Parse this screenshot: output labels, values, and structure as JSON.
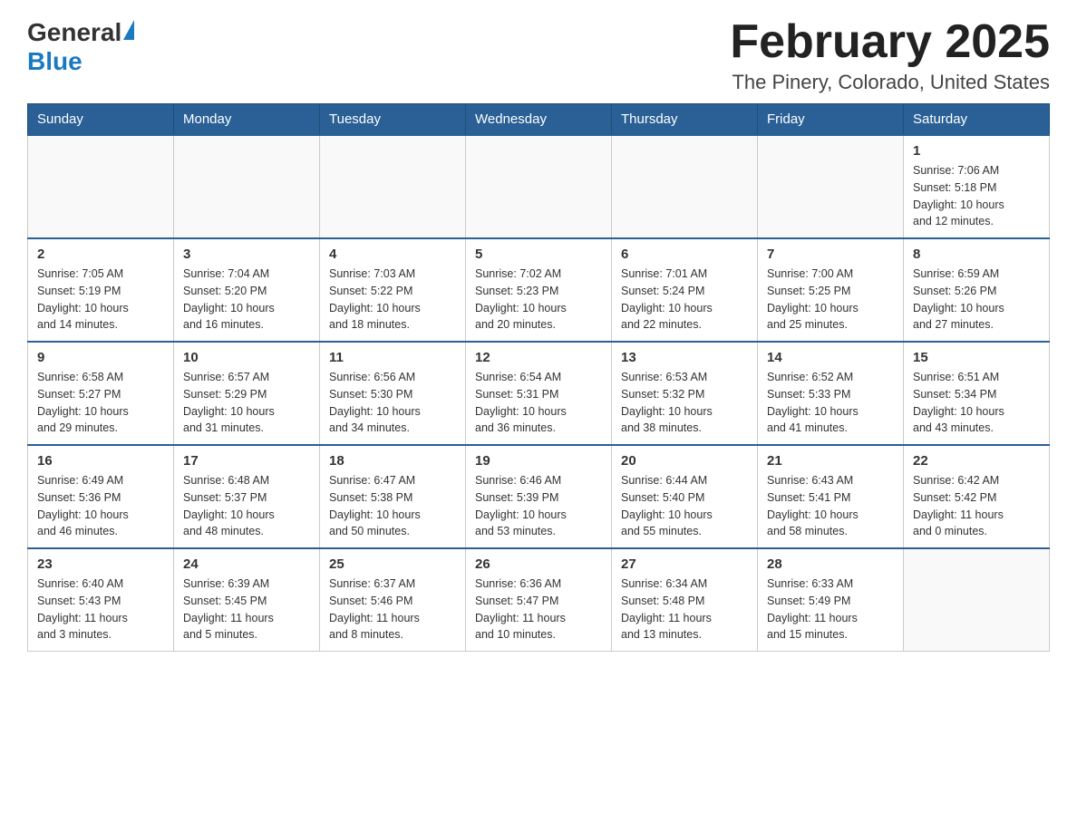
{
  "header": {
    "logo_general": "General",
    "logo_blue": "Blue",
    "month_year": "February 2025",
    "location": "The Pinery, Colorado, United States"
  },
  "weekdays": [
    "Sunday",
    "Monday",
    "Tuesday",
    "Wednesday",
    "Thursday",
    "Friday",
    "Saturday"
  ],
  "weeks": [
    [
      {
        "day": "",
        "info": ""
      },
      {
        "day": "",
        "info": ""
      },
      {
        "day": "",
        "info": ""
      },
      {
        "day": "",
        "info": ""
      },
      {
        "day": "",
        "info": ""
      },
      {
        "day": "",
        "info": ""
      },
      {
        "day": "1",
        "info": "Sunrise: 7:06 AM\nSunset: 5:18 PM\nDaylight: 10 hours\nand 12 minutes."
      }
    ],
    [
      {
        "day": "2",
        "info": "Sunrise: 7:05 AM\nSunset: 5:19 PM\nDaylight: 10 hours\nand 14 minutes."
      },
      {
        "day": "3",
        "info": "Sunrise: 7:04 AM\nSunset: 5:20 PM\nDaylight: 10 hours\nand 16 minutes."
      },
      {
        "day": "4",
        "info": "Sunrise: 7:03 AM\nSunset: 5:22 PM\nDaylight: 10 hours\nand 18 minutes."
      },
      {
        "day": "5",
        "info": "Sunrise: 7:02 AM\nSunset: 5:23 PM\nDaylight: 10 hours\nand 20 minutes."
      },
      {
        "day": "6",
        "info": "Sunrise: 7:01 AM\nSunset: 5:24 PM\nDaylight: 10 hours\nand 22 minutes."
      },
      {
        "day": "7",
        "info": "Sunrise: 7:00 AM\nSunset: 5:25 PM\nDaylight: 10 hours\nand 25 minutes."
      },
      {
        "day": "8",
        "info": "Sunrise: 6:59 AM\nSunset: 5:26 PM\nDaylight: 10 hours\nand 27 minutes."
      }
    ],
    [
      {
        "day": "9",
        "info": "Sunrise: 6:58 AM\nSunset: 5:27 PM\nDaylight: 10 hours\nand 29 minutes."
      },
      {
        "day": "10",
        "info": "Sunrise: 6:57 AM\nSunset: 5:29 PM\nDaylight: 10 hours\nand 31 minutes."
      },
      {
        "day": "11",
        "info": "Sunrise: 6:56 AM\nSunset: 5:30 PM\nDaylight: 10 hours\nand 34 minutes."
      },
      {
        "day": "12",
        "info": "Sunrise: 6:54 AM\nSunset: 5:31 PM\nDaylight: 10 hours\nand 36 minutes."
      },
      {
        "day": "13",
        "info": "Sunrise: 6:53 AM\nSunset: 5:32 PM\nDaylight: 10 hours\nand 38 minutes."
      },
      {
        "day": "14",
        "info": "Sunrise: 6:52 AM\nSunset: 5:33 PM\nDaylight: 10 hours\nand 41 minutes."
      },
      {
        "day": "15",
        "info": "Sunrise: 6:51 AM\nSunset: 5:34 PM\nDaylight: 10 hours\nand 43 minutes."
      }
    ],
    [
      {
        "day": "16",
        "info": "Sunrise: 6:49 AM\nSunset: 5:36 PM\nDaylight: 10 hours\nand 46 minutes."
      },
      {
        "day": "17",
        "info": "Sunrise: 6:48 AM\nSunset: 5:37 PM\nDaylight: 10 hours\nand 48 minutes."
      },
      {
        "day": "18",
        "info": "Sunrise: 6:47 AM\nSunset: 5:38 PM\nDaylight: 10 hours\nand 50 minutes."
      },
      {
        "day": "19",
        "info": "Sunrise: 6:46 AM\nSunset: 5:39 PM\nDaylight: 10 hours\nand 53 minutes."
      },
      {
        "day": "20",
        "info": "Sunrise: 6:44 AM\nSunset: 5:40 PM\nDaylight: 10 hours\nand 55 minutes."
      },
      {
        "day": "21",
        "info": "Sunrise: 6:43 AM\nSunset: 5:41 PM\nDaylight: 10 hours\nand 58 minutes."
      },
      {
        "day": "22",
        "info": "Sunrise: 6:42 AM\nSunset: 5:42 PM\nDaylight: 11 hours\nand 0 minutes."
      }
    ],
    [
      {
        "day": "23",
        "info": "Sunrise: 6:40 AM\nSunset: 5:43 PM\nDaylight: 11 hours\nand 3 minutes."
      },
      {
        "day": "24",
        "info": "Sunrise: 6:39 AM\nSunset: 5:45 PM\nDaylight: 11 hours\nand 5 minutes."
      },
      {
        "day": "25",
        "info": "Sunrise: 6:37 AM\nSunset: 5:46 PM\nDaylight: 11 hours\nand 8 minutes."
      },
      {
        "day": "26",
        "info": "Sunrise: 6:36 AM\nSunset: 5:47 PM\nDaylight: 11 hours\nand 10 minutes."
      },
      {
        "day": "27",
        "info": "Sunrise: 6:34 AM\nSunset: 5:48 PM\nDaylight: 11 hours\nand 13 minutes."
      },
      {
        "day": "28",
        "info": "Sunrise: 6:33 AM\nSunset: 5:49 PM\nDaylight: 11 hours\nand 15 minutes."
      },
      {
        "day": "",
        "info": ""
      }
    ]
  ]
}
